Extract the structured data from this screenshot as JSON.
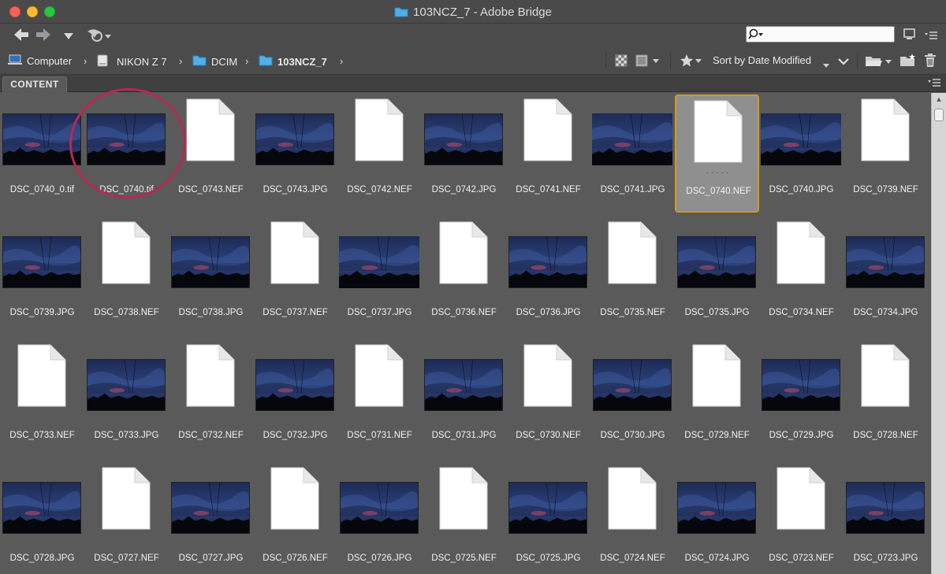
{
  "window": {
    "title": "103NCZ_7 - Adobe Bridge"
  },
  "colors": {
    "accent_selection": "#d39b1c",
    "annotation": "#b52a52",
    "folder": "#4fb0e8"
  },
  "toolbar": {
    "search_value": "",
    "icons": [
      "back-arrow-icon",
      "forward-arrow-icon",
      "dropdown-icon",
      "boomerang-icon",
      "search-icon",
      "compact-mode-icon",
      "panel-menu-icon"
    ]
  },
  "breadcrumb": [
    {
      "label": "Computer",
      "icon": "computer-icon"
    },
    {
      "label": "NIKON Z 7",
      "icon": "drive-icon"
    },
    {
      "label": "DCIM",
      "icon": "folder-icon"
    },
    {
      "label": "103NCZ_7",
      "icon": "folder-icon"
    }
  ],
  "sort": {
    "label": "Sort by Date Modified"
  },
  "panel": {
    "tab_label": "CONTENT"
  },
  "files": [
    {
      "name": "DSC_0740_0.tif",
      "kind": "photo"
    },
    {
      "name": "DSC_0740.tif",
      "kind": "photo"
    },
    {
      "name": "DSC_0743.NEF",
      "kind": "doc"
    },
    {
      "name": "DSC_0743.JPG",
      "kind": "photo"
    },
    {
      "name": "DSC_0742.NEF",
      "kind": "doc"
    },
    {
      "name": "DSC_0742.JPG",
      "kind": "photo"
    },
    {
      "name": "DSC_0741.NEF",
      "kind": "doc"
    },
    {
      "name": "DSC_0741.JPG",
      "kind": "photo-wide"
    },
    {
      "name": "DSC_0740.NEF",
      "kind": "doc",
      "selected": true
    },
    {
      "name": "DSC_0740.JPG",
      "kind": "photo-wide"
    },
    {
      "name": "DSC_0739.NEF",
      "kind": "doc"
    },
    {
      "name": "DSC_0739.JPG",
      "kind": "photo"
    },
    {
      "name": "DSC_0738.NEF",
      "kind": "doc"
    },
    {
      "name": "DSC_0738.JPG",
      "kind": "photo"
    },
    {
      "name": "DSC_0737.NEF",
      "kind": "doc"
    },
    {
      "name": "DSC_0737.JPG",
      "kind": "photo-wide"
    },
    {
      "name": "DSC_0736.NEF",
      "kind": "doc"
    },
    {
      "name": "DSC_0736.JPG",
      "kind": "photo"
    },
    {
      "name": "DSC_0735.NEF",
      "kind": "doc"
    },
    {
      "name": "DSC_0735.JPG",
      "kind": "photo"
    },
    {
      "name": "DSC_0734.NEF",
      "kind": "doc"
    },
    {
      "name": "DSC_0734.JPG",
      "kind": "photo"
    },
    {
      "name": "DSC_0733.NEF",
      "kind": "doc"
    },
    {
      "name": "DSC_0733.JPG",
      "kind": "photo"
    },
    {
      "name": "DSC_0732.NEF",
      "kind": "doc"
    },
    {
      "name": "DSC_0732.JPG",
      "kind": "photo"
    },
    {
      "name": "DSC_0731.NEF",
      "kind": "doc"
    },
    {
      "name": "DSC_0731.JPG",
      "kind": "photo"
    },
    {
      "name": "DSC_0730.NEF",
      "kind": "doc"
    },
    {
      "name": "DSC_0730.JPG",
      "kind": "photo"
    },
    {
      "name": "DSC_0729.NEF",
      "kind": "doc"
    },
    {
      "name": "DSC_0729.JPG",
      "kind": "photo"
    },
    {
      "name": "DSC_0728.NEF",
      "kind": "doc"
    },
    {
      "name": "DSC_0728.JPG",
      "kind": "photo"
    },
    {
      "name": "DSC_0727.NEF",
      "kind": "doc"
    },
    {
      "name": "DSC_0727.JPG",
      "kind": "photo"
    },
    {
      "name": "DSC_0726.NEF",
      "kind": "doc"
    },
    {
      "name": "DSC_0726.JPG",
      "kind": "photo"
    },
    {
      "name": "DSC_0725.NEF",
      "kind": "doc"
    },
    {
      "name": "DSC_0725.JPG",
      "kind": "photo"
    },
    {
      "name": "DSC_0724.NEF",
      "kind": "doc"
    },
    {
      "name": "DSC_0724.JPG",
      "kind": "photo"
    },
    {
      "name": "DSC_0723.NEF",
      "kind": "doc"
    },
    {
      "name": "DSC_0723.JPG",
      "kind": "photo"
    }
  ]
}
